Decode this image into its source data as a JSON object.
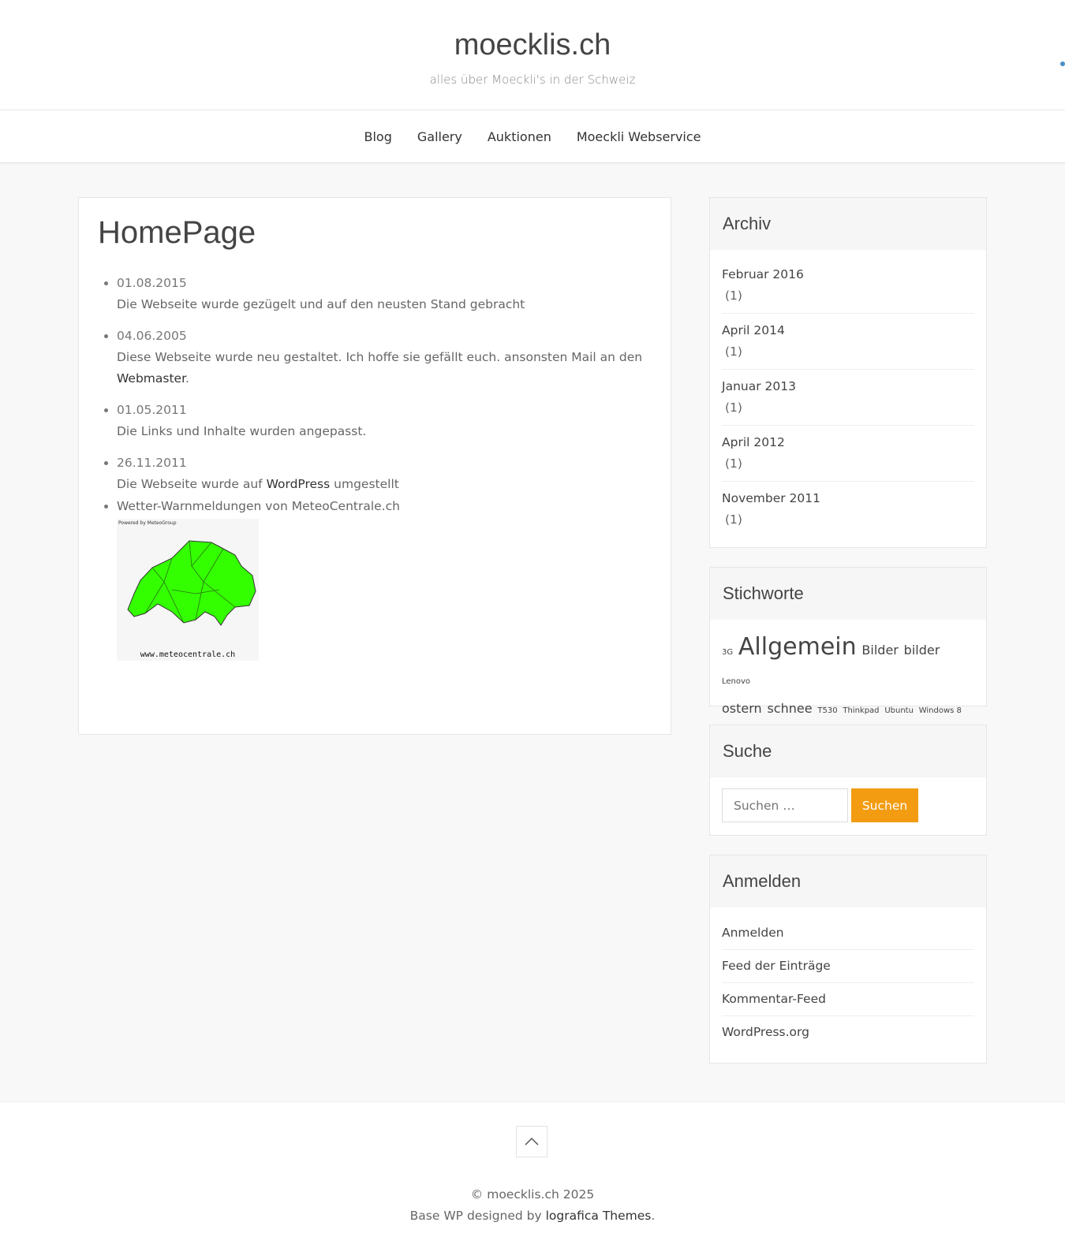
{
  "header": {
    "site_title": "moecklis.ch",
    "site_description": "alles über Moeckli's in der Schweiz"
  },
  "nav": {
    "items": [
      "Blog",
      "Gallery",
      "Auktionen",
      "Moeckli Webservice"
    ]
  },
  "main": {
    "page_title": "HomePage",
    "news": [
      {
        "date": "01.08.2015",
        "text": "Die Webseite wurde gezügelt und auf den neusten Stand gebracht"
      },
      {
        "date": "04.06.2005",
        "text_before": "Diese Webseite wurde neu gestaltet. Ich hoffe sie gefällt euch. ansonsten Mail an den",
        "link": "Webmaster",
        "text_after": "."
      },
      {
        "date": "01.05.2011",
        "text": "Die Links und Inhalte wurden angepasst."
      },
      {
        "date": "26.11.2011",
        "text_before": "Die Webseite wurde auf",
        "link": "WordPress",
        "text_after": "umgestellt"
      },
      {
        "text": "Wetter-Warnmeldungen von MeteoCentrale.ch"
      }
    ],
    "weather_map": {
      "powered_label": "Powered by MeteoGroup",
      "url_label": "www.meteocentrale.ch",
      "fill_color": "#33ff00"
    }
  },
  "sidebar": {
    "archive": {
      "title": "Archiv",
      "items": [
        {
          "label": "Februar 2016",
          "count": "(1)"
        },
        {
          "label": "April 2014",
          "count": "(1)"
        },
        {
          "label": "Januar 2013",
          "count": "(1)"
        },
        {
          "label": "April 2012",
          "count": "(1)"
        },
        {
          "label": "November 2011",
          "count": "(1)"
        }
      ]
    },
    "tags": {
      "title": "Stichworte",
      "items": [
        "3G",
        "Allgemein",
        "Bilder",
        "bilder",
        "Lenovo",
        "ostern",
        "schnee",
        "T530",
        "Thinkpad",
        "Ubuntu",
        "Windows 8"
      ]
    },
    "search": {
      "title": "Suche",
      "placeholder": "Suchen …",
      "button_label": "Suchen"
    },
    "login": {
      "title": "Anmelden",
      "items": [
        "Anmelden",
        "Feed der Einträge",
        "Kommentar-Feed",
        "WordPress.org"
      ]
    }
  },
  "footer": {
    "copyright": "© moecklis.ch 2025",
    "credits_before": "Base WP designed by",
    "credits_link": "lografica Themes",
    "credits_after": "."
  },
  "colors": {
    "accent": "#f39c12",
    "corner_dot": "#4a90c8"
  }
}
